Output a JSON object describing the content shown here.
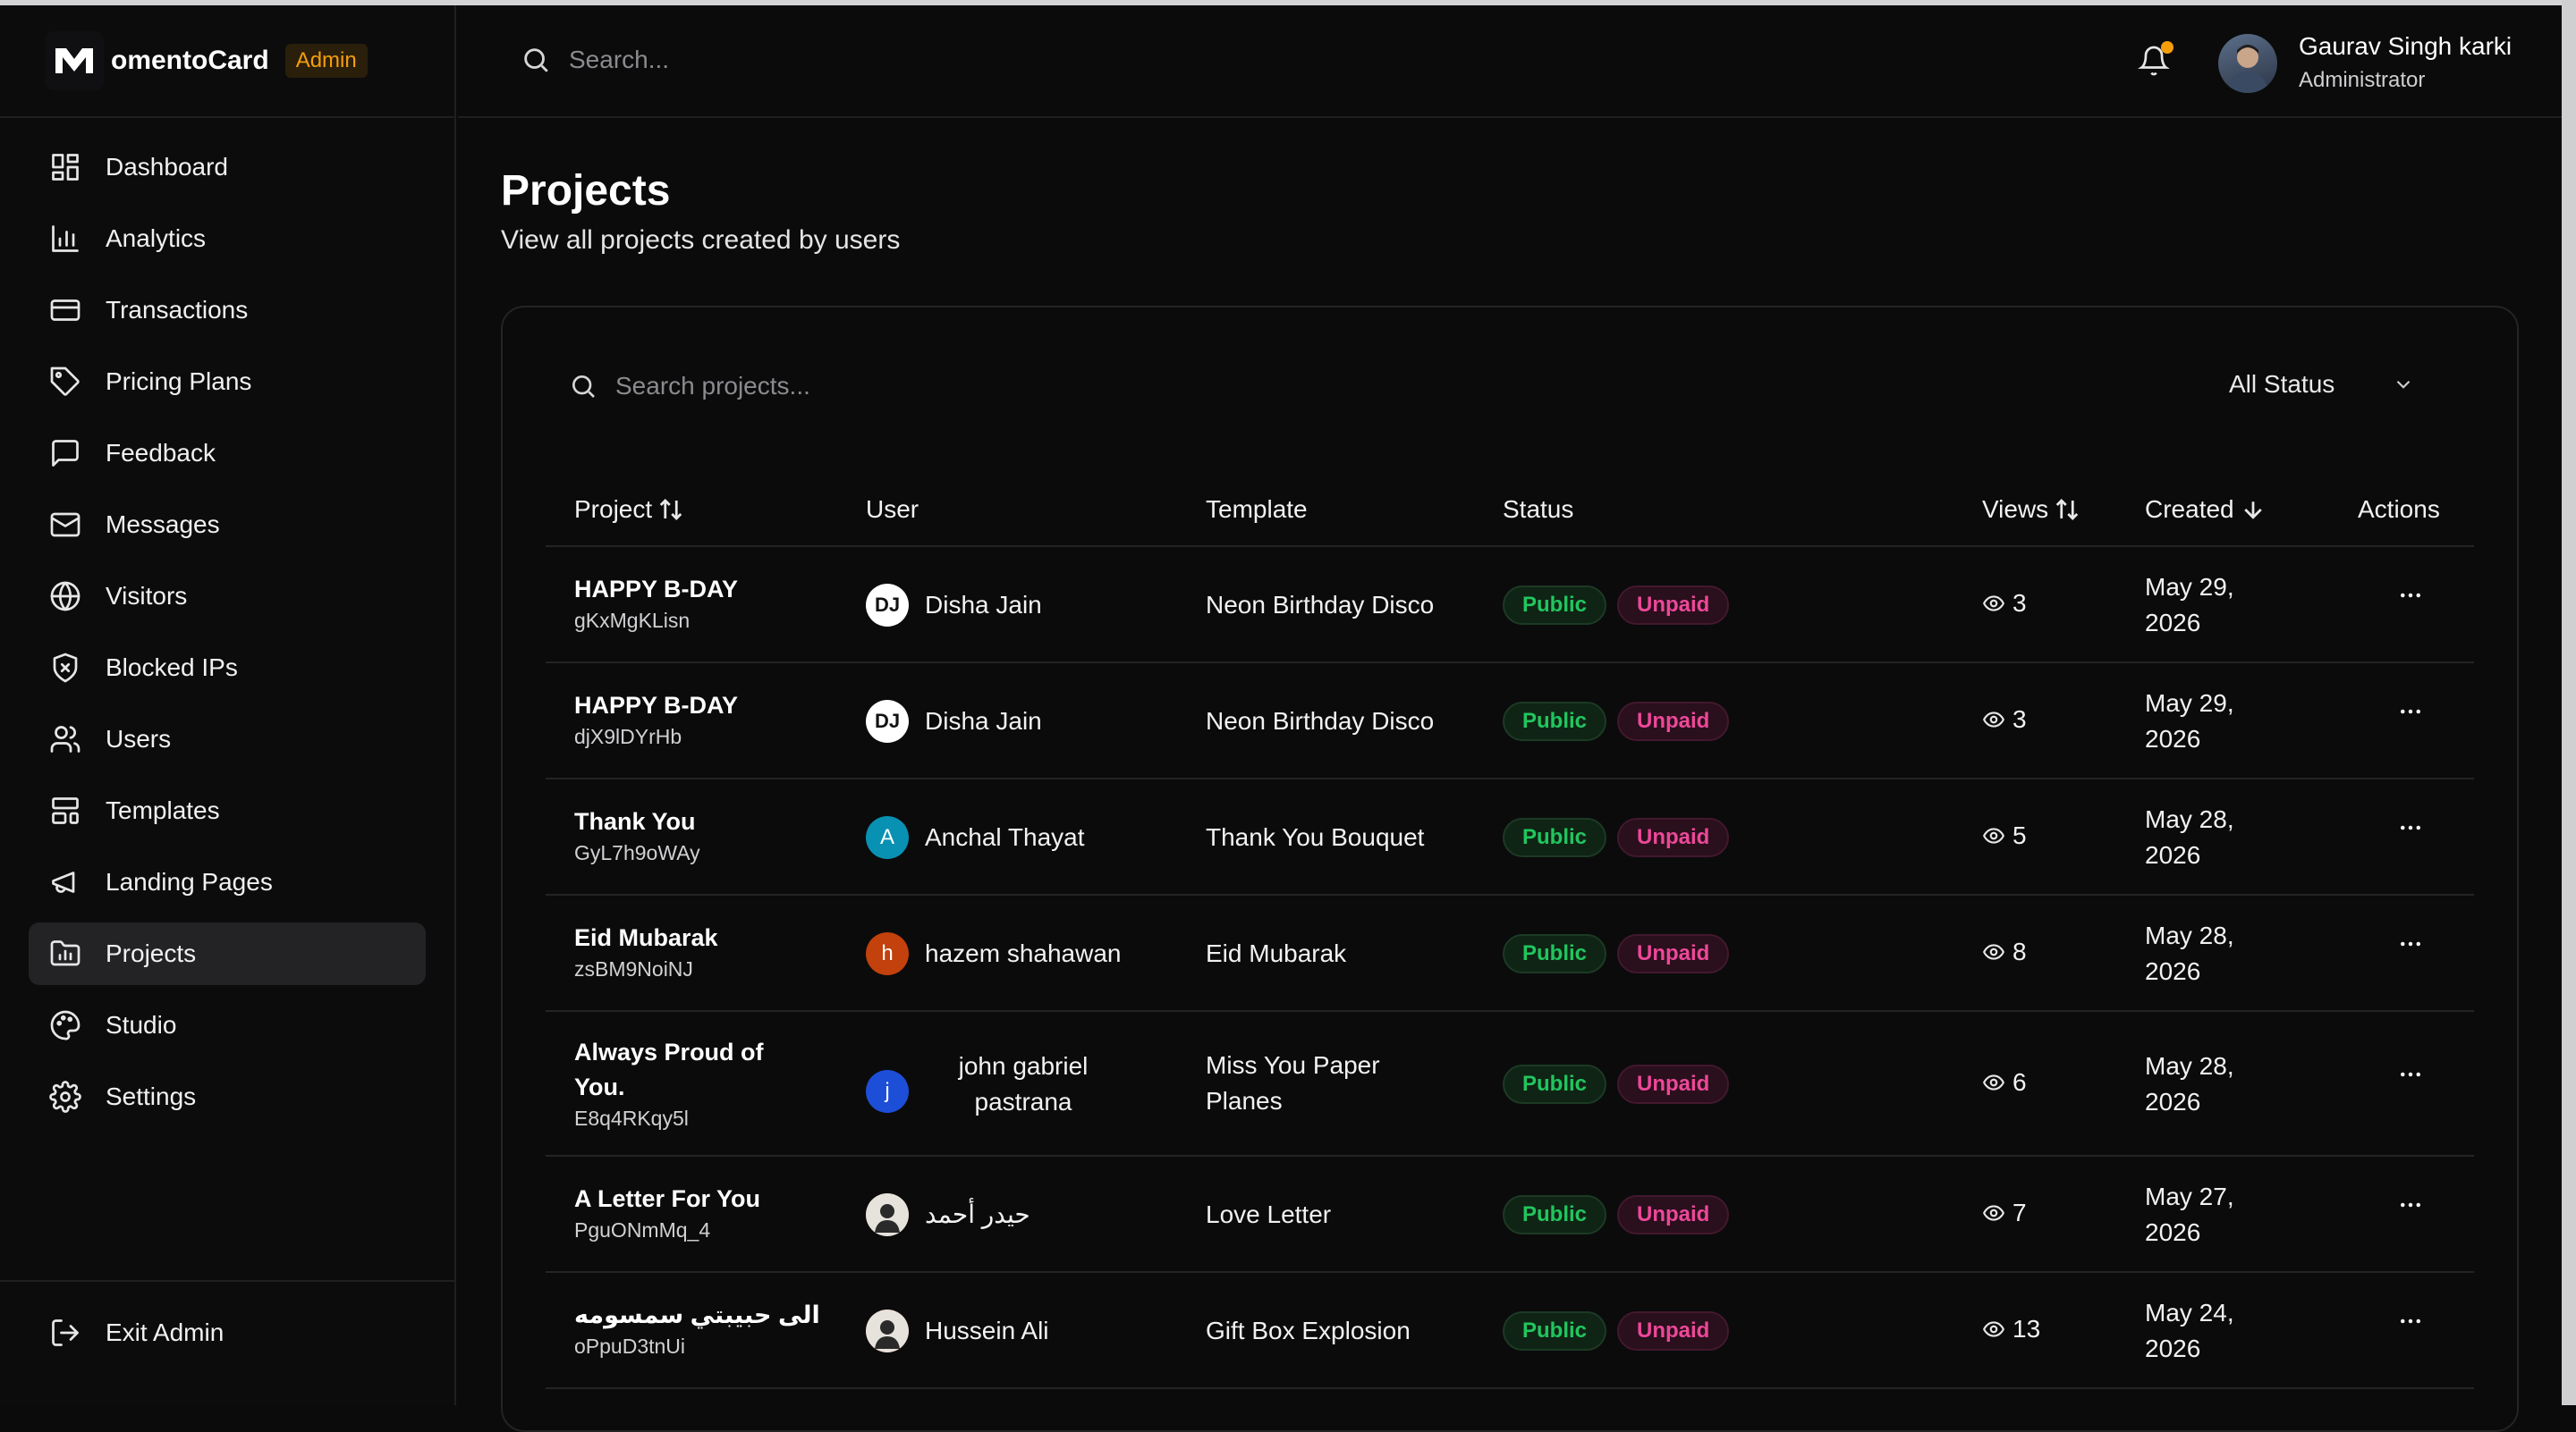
{
  "brand": {
    "name": "omentoCard",
    "badge": "Admin"
  },
  "nav": [
    {
      "label": "Dashboard",
      "icon": "dashboard-icon"
    },
    {
      "label": "Analytics",
      "icon": "analytics-icon"
    },
    {
      "label": "Transactions",
      "icon": "credit-card-icon"
    },
    {
      "label": "Pricing Plans",
      "icon": "tag-icon"
    },
    {
      "label": "Feedback",
      "icon": "message-square-icon"
    },
    {
      "label": "Messages",
      "icon": "mail-icon"
    },
    {
      "label": "Visitors",
      "icon": "globe-icon"
    },
    {
      "label": "Blocked IPs",
      "icon": "shield-x-icon"
    },
    {
      "label": "Users",
      "icon": "users-icon"
    },
    {
      "label": "Templates",
      "icon": "layout-template-icon"
    },
    {
      "label": "Landing Pages",
      "icon": "megaphone-icon"
    },
    {
      "label": "Projects",
      "icon": "folder-chart-icon",
      "active": true
    },
    {
      "label": "Studio",
      "icon": "palette-icon"
    },
    {
      "label": "Settings",
      "icon": "gear-icon"
    }
  ],
  "exit_label": "Exit Admin",
  "header": {
    "search_placeholder": "Search...",
    "user_name": "Gaurav Singh karki",
    "user_role": "Administrator",
    "notification_dot_color": "#f59e0b"
  },
  "page": {
    "title": "Projects",
    "subtitle": "View all projects created by users"
  },
  "filters": {
    "search_placeholder": "Search projects...",
    "status_value": "All Status"
  },
  "table": {
    "columns": {
      "project": "Project",
      "user": "User",
      "template": "Template",
      "status": "Status",
      "views": "Views",
      "created": "Created",
      "actions": "Actions"
    },
    "rows": [
      {
        "title": "HAPPY B-DAY",
        "code": "gKxMgKLisn",
        "user": "Disha Jain",
        "avatar": "DJ",
        "avatar_color": "#ffffff",
        "template": "Neon Birthday Disco",
        "status1": "Public",
        "status2": "Unpaid",
        "views": "3",
        "created": "May 29, 2026"
      },
      {
        "title": "HAPPY B-DAY",
        "code": "djX9lDYrHb",
        "user": "Disha Jain",
        "avatar": "DJ",
        "avatar_color": "#ffffff",
        "template": "Neon Birthday Disco",
        "status1": "Public",
        "status2": "Unpaid",
        "views": "3",
        "created": "May 29, 2026"
      },
      {
        "title": "Thank You",
        "code": "GyL7h9oWAy",
        "user": "Anchal Thayat",
        "avatar": "A",
        "avatar_color": "#0891b2",
        "template": "Thank You Bouquet",
        "status1": "Public",
        "status2": "Unpaid",
        "views": "5",
        "created": "May 28, 2026"
      },
      {
        "title": "Eid Mubarak",
        "code": "zsBM9NoiNJ",
        "user": "hazem shahawan",
        "avatar": "h",
        "avatar_color": "#c2410c",
        "template": "Eid Mubarak",
        "status1": "Public",
        "status2": "Unpaid",
        "views": "8",
        "created": "May 28, 2026"
      },
      {
        "title": "Always Proud of You.",
        "code": "E8q4RKqy5l",
        "user": "john gabriel pastrana",
        "avatar": "j",
        "avatar_color": "#1d4ed8",
        "template": "Miss You Paper Planes",
        "status1": "Public",
        "status2": "Unpaid",
        "views": "6",
        "created": "May 28, 2026"
      },
      {
        "title": "A Letter For You",
        "code": "PguONmMq_4",
        "user": "حيدر أحمد",
        "avatar": "",
        "avatar_color": "#6b5b4b",
        "template": "Love Letter",
        "status1": "Public",
        "status2": "Unpaid",
        "views": "7",
        "created": "May 27, 2026"
      },
      {
        "title": "الى حبيبتي سمسومه",
        "code": "oPpuD3tnUi",
        "user": "Hussein Ali",
        "avatar": "",
        "avatar_color": "#b91c1c",
        "template": "Gift Box Explosion",
        "status1": "Public",
        "status2": "Unpaid",
        "views": "13",
        "created": "May 24, 2026"
      }
    ]
  }
}
